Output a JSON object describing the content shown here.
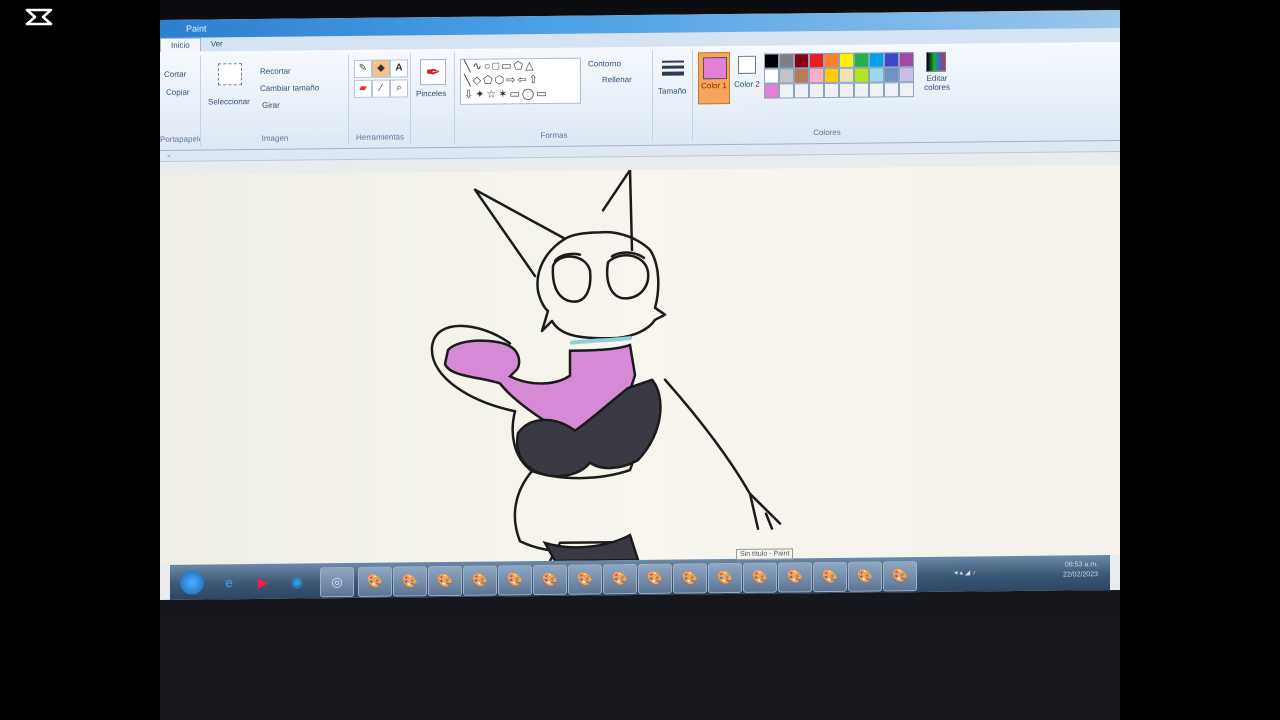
{
  "window": {
    "title": "Paint"
  },
  "tabs": [
    {
      "label": "Inicio"
    },
    {
      "label": "Ver"
    }
  ],
  "clipboard": {
    "cut": "Cortar",
    "copy": "Copiar",
    "label": "Portapapeles"
  },
  "image": {
    "select": "Seleccionar",
    "crop": "Recortar",
    "resize": "Cambiar tamaño",
    "rotate": "Girar",
    "label": "Imagen"
  },
  "tools": {
    "label": "Herramientas",
    "text_glyph": "A"
  },
  "brushes": {
    "label": "Pinceles"
  },
  "shapes": {
    "label": "Formas",
    "outline": "Contorno",
    "fill": "Rellenar"
  },
  "size": {
    "label": "Tamaño"
  },
  "colors": {
    "color1": "Color 1",
    "color2": "Color 2",
    "edit": "Editar colores",
    "label": "Colores",
    "color1_value": "#e47fd8",
    "color2_value": "#ffffff",
    "palette_row1": [
      "#000000",
      "#7f7f7f",
      "#880015",
      "#ed1c24",
      "#ff7f27",
      "#fff200",
      "#22b14c",
      "#00a2e8",
      "#3f48cc",
      "#a349a4"
    ],
    "palette_row2": [
      "#ffffff",
      "#c3c3c3",
      "#b97a57",
      "#ffaec9",
      "#ffc90e",
      "#efe4b0",
      "#b5e61d",
      "#99d9ea",
      "#7092be",
      "#c8bfe7"
    ],
    "palette_row3": [
      "#e47fd8",
      "",
      "",
      "",
      "",
      "",
      "",
      "",
      "",
      ""
    ]
  },
  "tooltip": "Sin título - Paint",
  "tray": {
    "time": "08:53 a.m.",
    "date": "22/02/2023"
  }
}
